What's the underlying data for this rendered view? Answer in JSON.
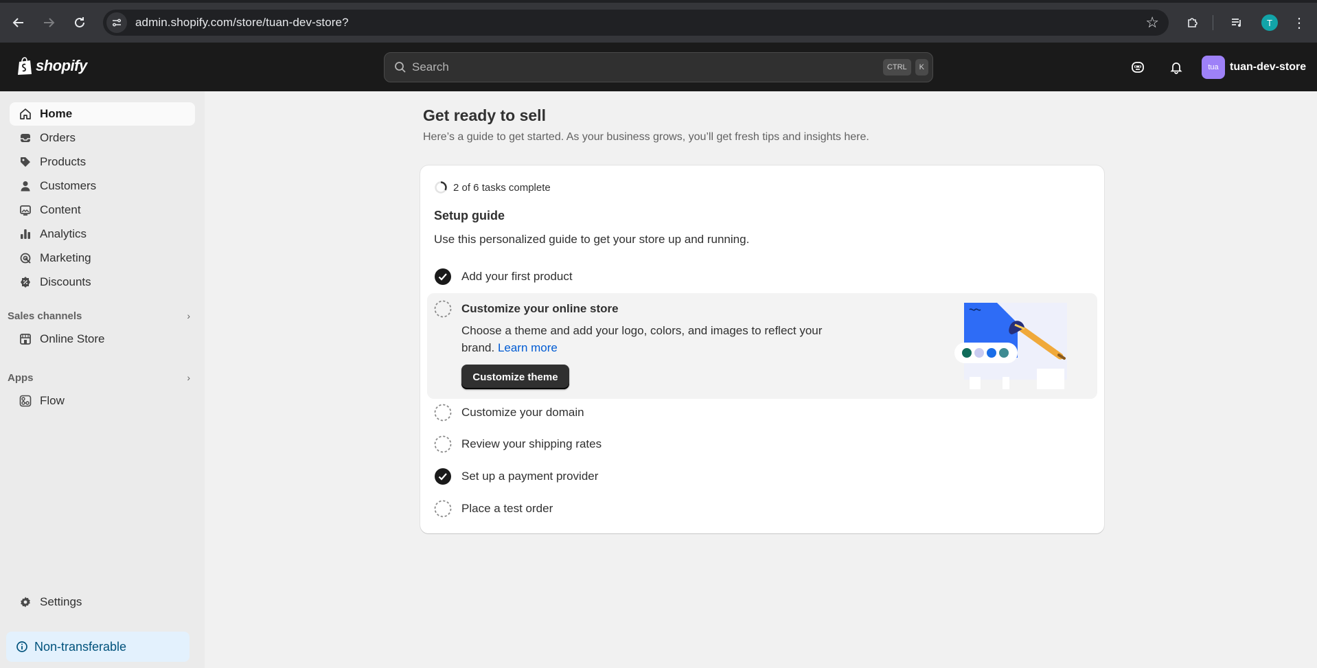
{
  "browser": {
    "url": "admin.shopify.com/store/tuan-dev-store?",
    "profile_initial": "T"
  },
  "header": {
    "logo_text": "shopify",
    "search_placeholder": "Search",
    "shortcut_keys": [
      "CTRL",
      "K"
    ],
    "store_avatar_text": "tua",
    "store_name": "tuan-dev-store"
  },
  "sidebar": {
    "items": [
      {
        "label": "Home",
        "icon": "home-icon",
        "active": true
      },
      {
        "label": "Orders",
        "icon": "inbox-icon"
      },
      {
        "label": "Products",
        "icon": "tag-icon"
      },
      {
        "label": "Customers",
        "icon": "person-icon"
      },
      {
        "label": "Content",
        "icon": "image-icon"
      },
      {
        "label": "Analytics",
        "icon": "bar-chart-icon"
      },
      {
        "label": "Marketing",
        "icon": "target-icon"
      },
      {
        "label": "Discounts",
        "icon": "discount-icon"
      }
    ],
    "sales_channels_label": "Sales channels",
    "online_store_label": "Online Store",
    "apps_label": "Apps",
    "flow_label": "Flow",
    "settings_label": "Settings",
    "notice_label": "Non-transferable"
  },
  "main": {
    "title": "Get ready to sell",
    "subtitle": "Here’s a guide to get started. As your business grows, you’ll get fresh tips and insights here.",
    "guide": {
      "progress_label": "2 of 6 tasks complete",
      "completed": 2,
      "total": 6,
      "title": "Setup guide",
      "description": "Use this personalized guide to get your store up and running.",
      "tasks": [
        {
          "label": "Add your first product",
          "done": true
        },
        {
          "label": "Customize your online store",
          "done": false,
          "expanded": true
        },
        {
          "label": "Customize your domain",
          "done": false
        },
        {
          "label": "Review your shipping rates",
          "done": false
        },
        {
          "label": "Set up a payment provider",
          "done": true
        },
        {
          "label": "Place a test order",
          "done": false
        }
      ],
      "expanded_desc": "Choose a theme and add your logo, colors, and images to reflect your brand.",
      "expanded_link": "Learn more",
      "expanded_button": "Customize theme"
    }
  },
  "colors": {
    "accent_link": "#005bd3",
    "primary_button": "#303030",
    "store_avatar": "#9e81f8",
    "notice_bg": "#e3f1fd"
  }
}
